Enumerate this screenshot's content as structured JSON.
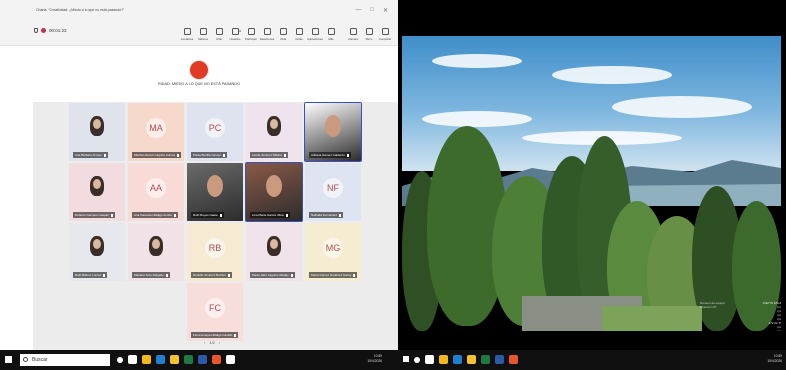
{
  "app": {
    "window_title": "Charla: \"Creatividad: ¿Miedo a lo que no está pasando?\"",
    "meeting_timer": "00:01:23",
    "window_buttons": [
      "—",
      "□",
      "✕"
    ]
  },
  "toolbar": {
    "tools": [
      {
        "label": "Contactos",
        "icon": "contacts-icon"
      },
      {
        "label": "Salones",
        "icon": "breakout-icon"
      },
      {
        "label": "Chat",
        "icon": "chat-icon"
      },
      {
        "label": "Usuarios",
        "icon": "people-icon",
        "badge": "34"
      },
      {
        "label": "Participar",
        "icon": "raise-hand-icon"
      },
      {
        "label": "Reacciones",
        "icon": "reactions-icon"
      },
      {
        "label": "Vista",
        "icon": "view-icon"
      },
      {
        "label": "Notas",
        "icon": "notes-icon"
      },
      {
        "label": "Aplicaciones",
        "icon": "apps-icon"
      },
      {
        "label": "Más",
        "icon": "more-icon"
      },
      {
        "label": "Cámara",
        "icon": "camera-icon"
      },
      {
        "label": "Micro",
        "icon": "mic-icon"
      },
      {
        "label": "Compartir",
        "icon": "share-icon"
      },
      {
        "label": "Salir",
        "icon": "leave-icon"
      }
    ]
  },
  "stage": {
    "title": "RIDAD: MIEDO A LO QUE NO ESTÁ PASANDO"
  },
  "participants": [
    {
      "name": "Ana Bárbara Amayo",
      "initials": "",
      "color": "#dfe4ec",
      "photo": true
    },
    {
      "name": "Maribel Alarcón Higuita Jaimes",
      "initials": "MA",
      "color": "#f6d9cc"
    },
    {
      "name": "Paula Bonilla Campo",
      "initials": "PC",
      "color": "#dfe3f0"
    },
    {
      "name": "Lenda Jiménez Milano",
      "initials": "",
      "color": "#efe4ee",
      "photo": true
    },
    {
      "name": "Adriana Gómez Calderón",
      "initials": "",
      "color": "#ffffff",
      "camera": true,
      "selected": true
    },
    {
      "name": "Roberto Campos Gaspari",
      "initials": "",
      "color": "#f3dcdf",
      "photo": true
    },
    {
      "name": "Ana Vanessa Hidalgo Acuña",
      "initials": "AA",
      "color": "#f8dad7"
    },
    {
      "name": "Ruth Reyes Gaete",
      "initials": "",
      "color": "#6b6b6b",
      "camera": true
    },
    {
      "name": "Lina María García Ulloa",
      "initials": "",
      "color": "#8a5a48",
      "camera": true,
      "selected": true
    },
    {
      "name": "Nathalia Fernández",
      "initials": "NF",
      "color": "#dfe4f2"
    },
    {
      "name": "Ruth Blanco Lomes",
      "initials": "",
      "color": "#e6e8ee",
      "photo": true
    },
    {
      "name": "Mariana Soto Delgado",
      "initials": "",
      "color": "#f0e2e6",
      "photo": true
    },
    {
      "name": "Rodolfo Jiménez Barrios",
      "initials": "RB",
      "color": "#f7ead3"
    },
    {
      "name": "Paula Jairo Laguna Hidalgo",
      "initials": "",
      "color": "#f0e3ec",
      "photo": true
    },
    {
      "name": "María Gómez Gutiérrez Garay",
      "initials": "MG",
      "color": "#f5ecd2"
    },
    {
      "name": "Fiona Amaya Hidalgo Cantillo",
      "initials": "FC",
      "color": "#f7dedb"
    }
  ],
  "gallery": {
    "pager": "1/2"
  },
  "taskbar_left": {
    "search_placeholder": "Buscar",
    "tray_time": "10:59",
    "tray_date": "15/4/2026"
  },
  "taskbar_right": {
    "tray_time": "10:59",
    "tray_date": "15/4/2026"
  },
  "wallpaper_info": [
    {
      "k": "Número de equipo:",
      "v": "1VE770 FAGBDE"
    },
    {
      "k": "Dirección IP:",
      "v": "(none)"
    },
    {
      "k": "",
      "v": "(none)"
    },
    {
      "k": "",
      "v": "(none)"
    },
    {
      "k": "",
      "v": "(none)"
    },
    {
      "k": "",
      "v": "172.22.79.87"
    },
    {
      "k": "",
      "v": "(none)"
    },
    {
      "k": "",
      "v": "(none)"
    },
    {
      "k": "",
      "v": "(none)"
    },
    {
      "k": "",
      "v": "(none)"
    },
    {
      "k": "",
      "v": "172.22.79.87"
    },
    {
      "k": "",
      "v": "(none)"
    },
    {
      "k": "",
      "v": "(none)"
    },
    {
      "k": "Usuario:",
      "v": "alfonteva"
    }
  ]
}
